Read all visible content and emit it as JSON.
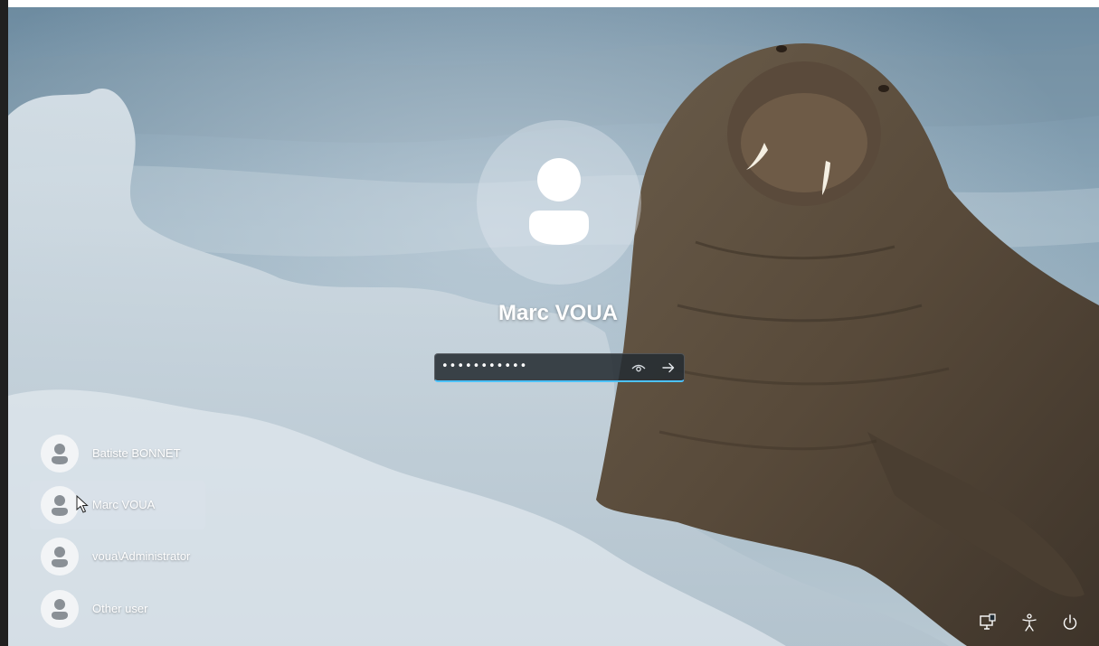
{
  "main_user": {
    "name": "Marc VOUA"
  },
  "password": {
    "masked_value": "•••••••••••",
    "reveal_icon": "eye-icon",
    "submit_icon": "arrow-right-icon",
    "accent_color": "#4cc2ff"
  },
  "users": [
    {
      "name": "Batiste BONNET",
      "selected": false
    },
    {
      "name": "Marc VOUA",
      "selected": true
    },
    {
      "name": "voua\\Administrator",
      "selected": false
    },
    {
      "name": "Other user",
      "selected": false
    }
  ],
  "system_buttons": [
    {
      "icon": "network-icon"
    },
    {
      "icon": "accessibility-icon"
    },
    {
      "icon": "power-icon"
    }
  ]
}
